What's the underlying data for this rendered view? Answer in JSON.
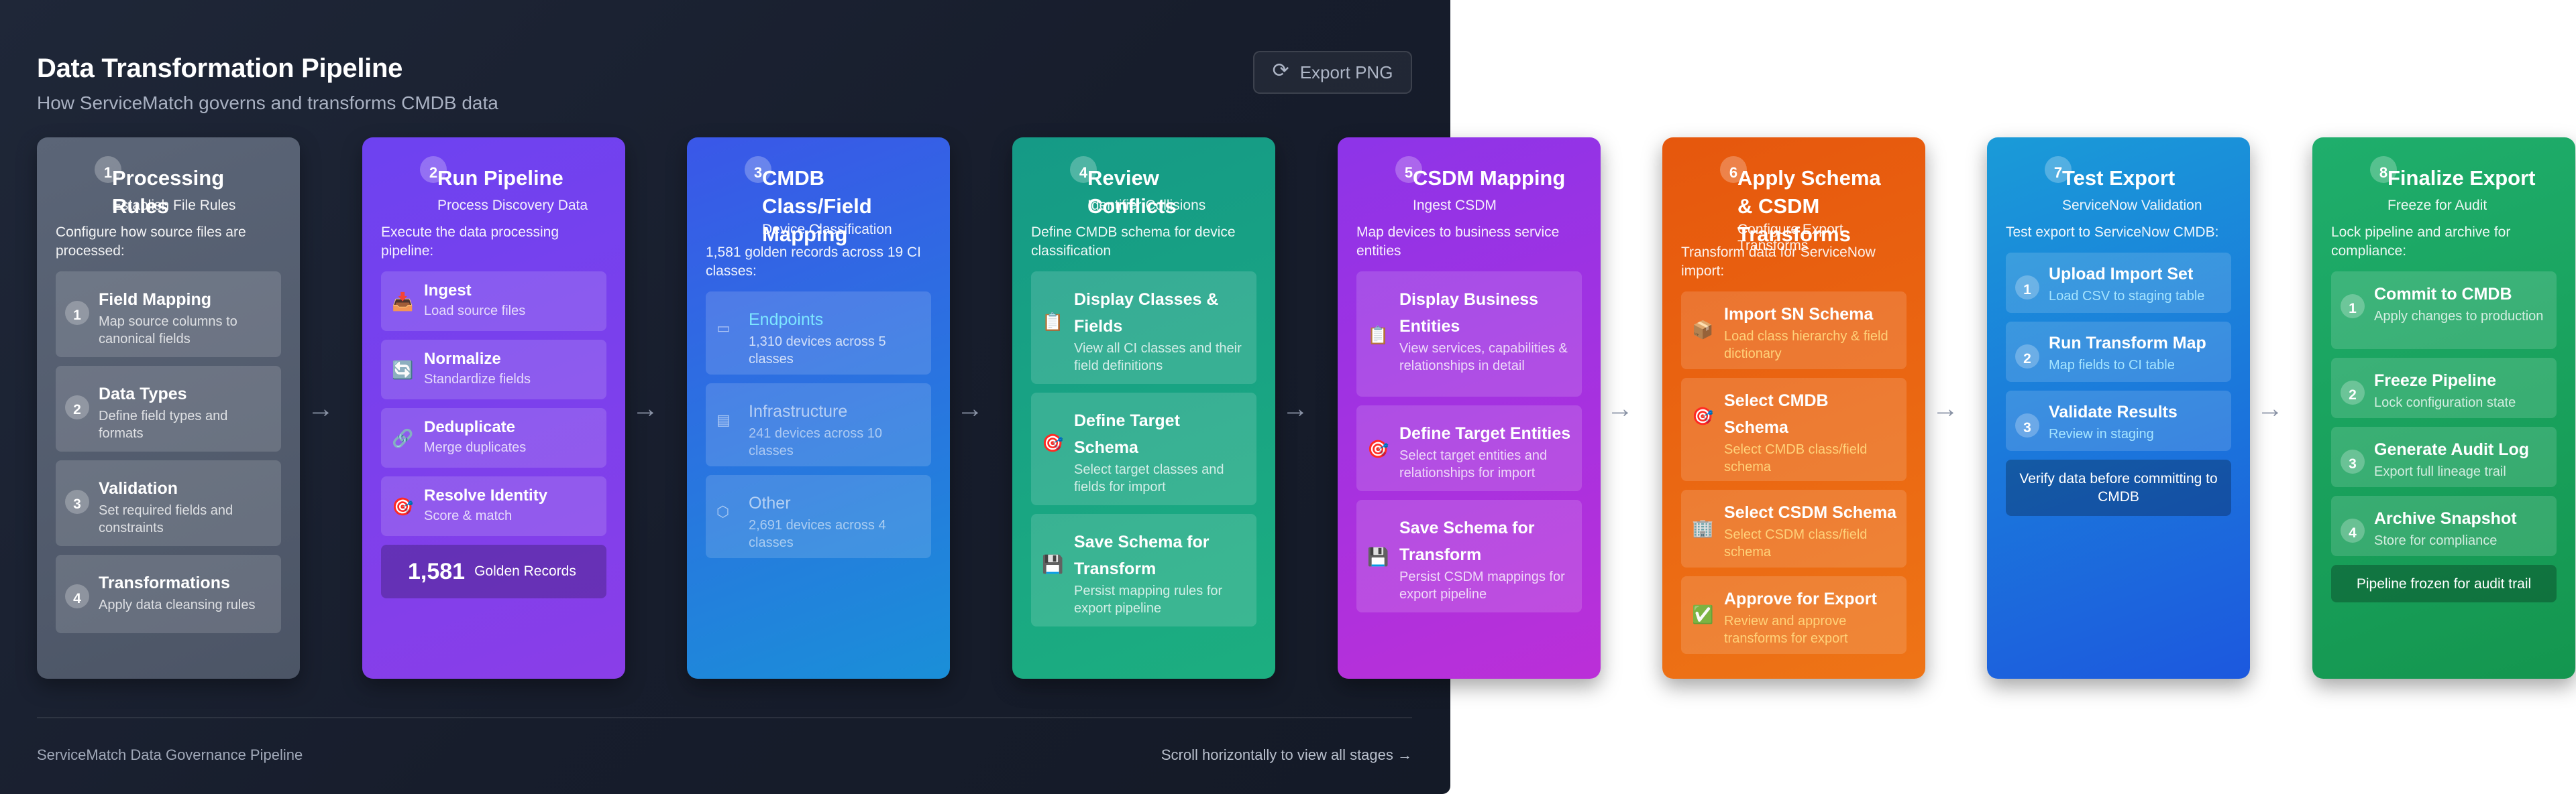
{
  "header": {
    "title": "Data Transformation Pipeline",
    "subtitle": "How ServiceMatch governs and transforms CMDB data",
    "export_label": "Export PNG",
    "export_icon": "refresh-icon"
  },
  "footer": {
    "left": "ServiceMatch Data Governance Pipeline",
    "right": "Scroll horizontally to view all stages →"
  },
  "arrow_glyph": "→",
  "stages": [
    {
      "num": "1",
      "title": "Processing Rules",
      "sub": "Establish File Rules",
      "desc": "Configure how source files are processed:",
      "items": [
        {
          "n": "1",
          "t": "Field Mapping",
          "s": "Map source columns to canonical fields"
        },
        {
          "n": "2",
          "t": "Data Types",
          "s": "Define field types and formats"
        },
        {
          "n": "3",
          "t": "Validation",
          "s": "Set required fields and constraints"
        },
        {
          "n": "4",
          "t": "Transformations",
          "s": "Apply data cleansing rules"
        }
      ]
    },
    {
      "num": "2",
      "title": "Run Pipeline",
      "sub": "Process Discovery Data",
      "desc": "Execute the data processing pipeline:",
      "items": [
        {
          "ic": "📥",
          "t": "Ingest",
          "s": "Load source files"
        },
        {
          "ic": "🔄",
          "t": "Normalize",
          "s": "Standardize fields"
        },
        {
          "ic": "🔗",
          "t": "Deduplicate",
          "s": "Merge duplicates"
        },
        {
          "ic": "🎯",
          "t": "Resolve Identity",
          "s": "Score & match"
        }
      ],
      "golden_value": "1,581",
      "golden_label": "Golden Records"
    },
    {
      "num": "3",
      "title": "CMDB Class/Field Mapping",
      "sub": "Device Classification",
      "desc": "1,581 golden records across 19 CI classes:",
      "items": [
        {
          "ic": "▭",
          "t": "Endpoints",
          "s": "1,310 devices across 5 classes"
        },
        {
          "ic": "▤",
          "t": "Infrastructure",
          "s": "241 devices across 10 classes"
        },
        {
          "ic": "⬡",
          "t": "Other",
          "s": "2,691 devices across 4 classes"
        }
      ]
    },
    {
      "num": "4",
      "title": "Review Conflicts",
      "sub": "Identifier Collisions",
      "desc": "Define CMDB schema for device classification",
      "items": [
        {
          "ic": "📋",
          "t": "Display Classes & Fields",
          "s": "View all CI classes and their field definitions"
        },
        {
          "ic": "🎯",
          "t": "Define Target Schema",
          "s": "Select target classes and fields for import"
        },
        {
          "ic": "💾",
          "t": "Save Schema for Transform",
          "s": "Persist mapping rules for export pipeline"
        }
      ]
    },
    {
      "num": "5",
      "title": "CSDM Mapping",
      "sub": "Ingest CSDM",
      "desc": "Map devices to business service entities",
      "items": [
        {
          "ic": "📋",
          "t": "Display Business Entities",
          "s": "View services, capabilities & relationships in detail"
        },
        {
          "ic": "🎯",
          "t": "Define Target Entities",
          "s": "Select target entities and relationships for import"
        },
        {
          "ic": "💾",
          "t": "Save Schema for Transform",
          "s": "Persist CSDM mappings for export pipeline"
        }
      ]
    },
    {
      "num": "6",
      "title": "Apply Schema & CSDM Transforms",
      "sub": "Configure Export Transforms",
      "desc": "Transform data for ServiceNow import:",
      "items": [
        {
          "ic": "📦",
          "t": "Import SN Schema",
          "s": "Load class hierarchy & field dictionary"
        },
        {
          "ic": "🎯",
          "t": "Select CMDB Schema",
          "s": "Select CMDB class/field schema"
        },
        {
          "ic": "🏢",
          "t": "Select CSDM Schema",
          "s": "Select CSDM class/field schema"
        },
        {
          "ic": "✅",
          "t": "Approve for Export",
          "s": "Review and approve transforms for export"
        }
      ]
    },
    {
      "num": "7",
      "title": "Test Export",
      "sub": "ServiceNow Validation",
      "desc": "Test export to ServiceNow CMDB:",
      "items": [
        {
          "n": "1",
          "t": "Upload Import Set",
          "s": "Load CSV to staging table"
        },
        {
          "n": "2",
          "t": "Run Transform Map",
          "s": "Map fields to CI table"
        },
        {
          "n": "3",
          "t": "Validate Results",
          "s": "Review in staging"
        }
      ],
      "note": "Verify data before committing to CMDB"
    },
    {
      "num": "8",
      "title": "Finalize Export",
      "sub": "Freeze for Audit",
      "desc": "Lock pipeline and archive for compliance:",
      "items": [
        {
          "n": "1",
          "t": "Commit to CMDB",
          "s": "Apply changes to production"
        },
        {
          "n": "2",
          "t": "Freeze Pipeline",
          "s": "Lock configuration state"
        },
        {
          "n": "3",
          "t": "Generate Audit Log",
          "s": "Export full lineage trail"
        },
        {
          "n": "4",
          "t": "Archive Snapshot",
          "s": "Store for compliance"
        }
      ],
      "note": "Pipeline frozen for audit trail"
    }
  ]
}
